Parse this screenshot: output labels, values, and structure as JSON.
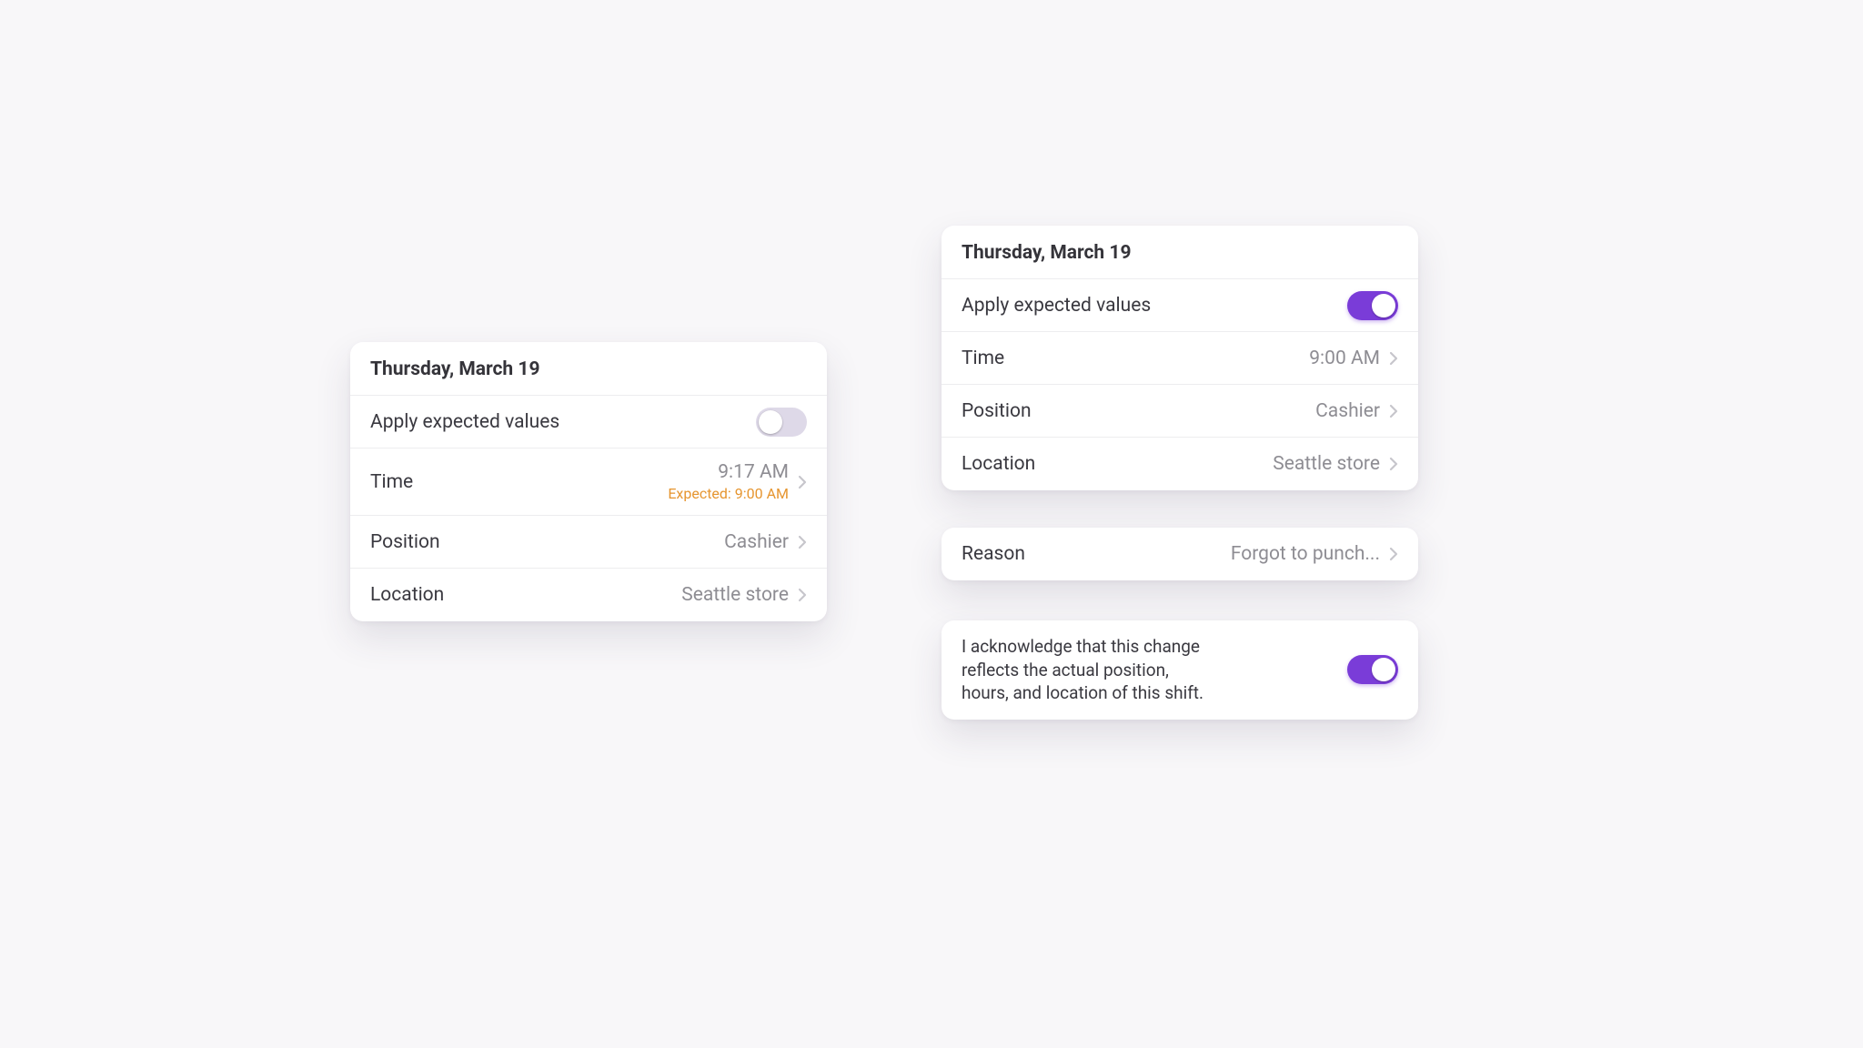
{
  "left": {
    "header": "Thursday, March 19",
    "apply_label": "Apply expected values",
    "time_label": "Time",
    "time_value": "9:17 AM",
    "time_expected": "Expected: 9:00 AM",
    "position_label": "Position",
    "position_value": "Cashier",
    "location_label": "Location",
    "location_value": "Seattle store"
  },
  "right": {
    "header": "Thursday, March 19",
    "apply_label": "Apply expected values",
    "time_label": "Time",
    "time_value": "9:00 AM",
    "position_label": "Position",
    "position_value": "Cashier",
    "location_label": "Location",
    "location_value": "Seattle store"
  },
  "reason": {
    "label": "Reason",
    "value": "Forgot to punch..."
  },
  "ack": {
    "text": "I acknowledge that this change reflects the actual position, hours, and location of this shift."
  }
}
